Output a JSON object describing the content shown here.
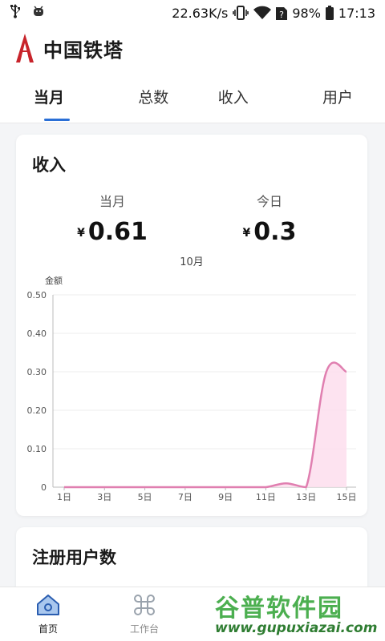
{
  "status_bar": {
    "speed": "22.63K/s",
    "battery": "98%",
    "time": "17:13",
    "icons": [
      "usb-icon",
      "android-debug-icon",
      "vibrate-icon",
      "wifi-icon",
      "sim-unknown-icon",
      "battery-icon"
    ]
  },
  "header": {
    "title": "中国铁塔",
    "logo": "china-tower-logo"
  },
  "tabs": [
    {
      "label": "当月",
      "active": true
    },
    {
      "label": "总数",
      "active": false
    },
    {
      "label": "收入",
      "active": false
    },
    {
      "label": "用户",
      "active": false
    }
  ],
  "income_card": {
    "title": "收入",
    "month": {
      "label": "当月",
      "currency": "¥",
      "value": "0.61"
    },
    "today": {
      "label": "今日",
      "currency": "¥",
      "value": "0.3"
    }
  },
  "chart_data": {
    "type": "area",
    "title": "10月",
    "ylabel": "金额",
    "xlabel": "",
    "x": [
      1,
      2,
      3,
      4,
      5,
      6,
      7,
      8,
      9,
      10,
      11,
      12,
      13,
      14,
      15
    ],
    "x_tick_labels": [
      "1日",
      "3日",
      "5日",
      "7日",
      "9日",
      "11日",
      "13日",
      "15日"
    ],
    "x_tick_values": [
      1,
      3,
      5,
      7,
      9,
      11,
      13,
      15
    ],
    "y_tick_labels": [
      "0",
      "0.10",
      "0.20",
      "0.30",
      "0.40",
      "0.50"
    ],
    "ylim": [
      0,
      0.5
    ],
    "values": [
      0,
      0,
      0,
      0,
      0,
      0,
      0,
      0,
      0,
      0,
      0,
      0.01,
      0,
      0.3,
      0.3
    ],
    "grid": true,
    "color": "#e07fb0",
    "fill_color": "#fde0ee"
  },
  "users_card": {
    "title": "注册用户数"
  },
  "bottom_nav": [
    {
      "label": "首页",
      "icon": "home-icon",
      "active": true
    },
    {
      "label": "工作台",
      "icon": "command-icon",
      "active": false
    }
  ],
  "watermark": {
    "name": "谷普软件园",
    "url": "www.gupuxiazai.com"
  }
}
